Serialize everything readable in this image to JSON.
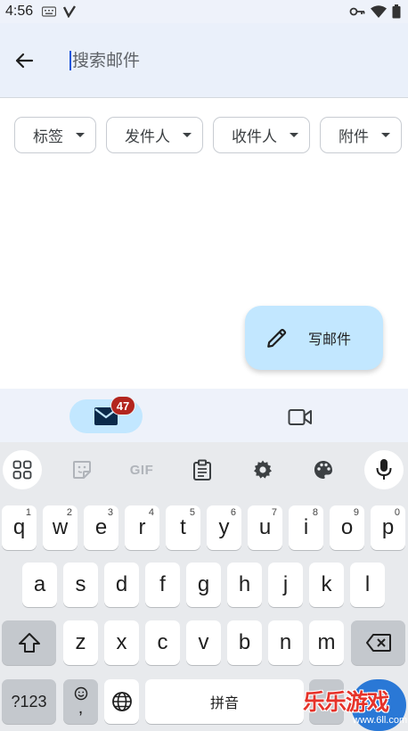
{
  "status_bar": {
    "time": "4:56",
    "left_icons": [
      "keyboard-icon",
      "v-app-icon"
    ],
    "right_icons": [
      "key-icon",
      "wifi-icon",
      "battery-icon"
    ]
  },
  "search": {
    "back_icon": "arrow-left-icon",
    "placeholder": "搜索邮件"
  },
  "filters": [
    {
      "label": "标签"
    },
    {
      "label": "发件人"
    },
    {
      "label": "收件人"
    },
    {
      "label": "附件"
    }
  ],
  "compose": {
    "icon": "pencil-icon",
    "label": "写邮件"
  },
  "bottom_nav": {
    "mail_badge": "47",
    "mail_icon": "mail-icon",
    "meet_icon": "video-icon"
  },
  "keyboard": {
    "toolbar": [
      "apps-grid-icon",
      "sticker-icon",
      "GIF",
      "clipboard-icon",
      "settings-icon",
      "palette-icon",
      "mic-icon"
    ],
    "gif_label": "GIF",
    "row1": [
      {
        "key": "q",
        "hint": "1"
      },
      {
        "key": "w",
        "hint": "2"
      },
      {
        "key": "e",
        "hint": "3"
      },
      {
        "key": "r",
        "hint": "4"
      },
      {
        "key": "t",
        "hint": "5"
      },
      {
        "key": "y",
        "hint": "6"
      },
      {
        "key": "u",
        "hint": "7"
      },
      {
        "key": "i",
        "hint": "8"
      },
      {
        "key": "o",
        "hint": "9"
      },
      {
        "key": "p",
        "hint": "0"
      }
    ],
    "row2": [
      "a",
      "s",
      "d",
      "f",
      "g",
      "h",
      "j",
      "k",
      "l"
    ],
    "row3": [
      "z",
      "x",
      "c",
      "v",
      "b",
      "n",
      "m"
    ],
    "symbols_label": "?123",
    "emoji_comma": ",",
    "space_label": "拼音"
  },
  "watermark": {
    "text": "乐乐游戏",
    "url": "www.6ll.com"
  },
  "colors": {
    "header_bg": "#eaf0fa",
    "fab_bg": "#c2e7ff",
    "badge": "#b3261e",
    "keyboard_bg": "#e8eaed"
  }
}
